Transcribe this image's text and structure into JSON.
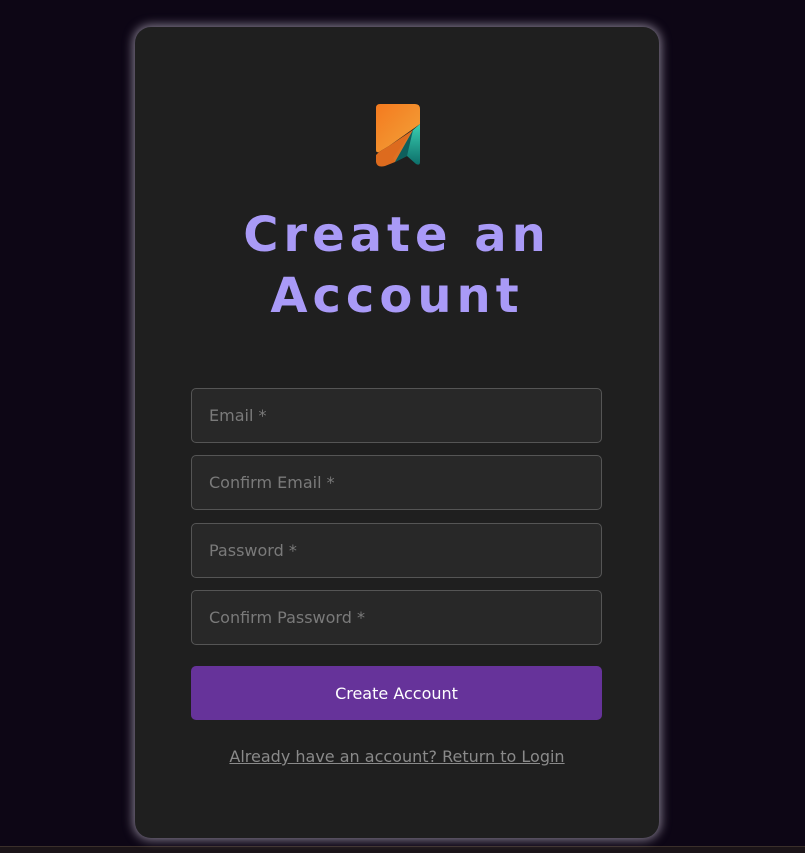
{
  "signup": {
    "title": "Create an Account",
    "fields": {
      "email_placeholder": "Email *",
      "confirm_email_placeholder": "Confirm Email *",
      "password_placeholder": "Password *",
      "confirm_password_placeholder": "Confirm Password *"
    },
    "submit_label": "Create Account",
    "login_link": "Already have an account? Return to Login"
  },
  "colors": {
    "page_background": "#0d0615",
    "card_background": "#1f1f1f",
    "title": "#a99af7",
    "button": "#66339a",
    "logo_orange": "#f2761c",
    "logo_teal": "#1aa99a"
  },
  "icons": {
    "logo": "app-logo-icon"
  }
}
